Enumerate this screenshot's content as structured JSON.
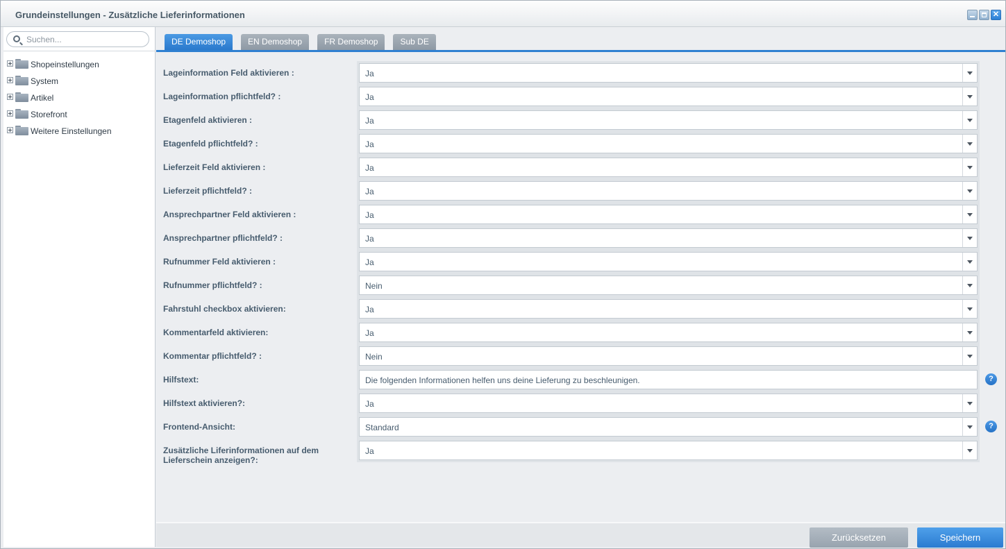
{
  "window": {
    "title": "Grundeinstellungen - Zusätzliche Lieferinformationen"
  },
  "sidebar": {
    "search": {
      "placeholder": "Suchen..."
    },
    "tree": [
      {
        "label": "Shopeinstellungen"
      },
      {
        "label": "System"
      },
      {
        "label": "Artikel"
      },
      {
        "label": "Storefront"
      },
      {
        "label": "Weitere Einstellungen"
      }
    ]
  },
  "tabs": [
    {
      "label": "DE Demoshop",
      "active": true
    },
    {
      "label": "EN Demoshop",
      "active": false
    },
    {
      "label": "FR Demoshop",
      "active": false
    },
    {
      "label": "Sub DE",
      "active": false
    }
  ],
  "form": {
    "rows": [
      {
        "label": "Lageinformation Feld aktivieren :",
        "value": "Ja"
      },
      {
        "label": "Lageinformation pflichtfeld? :",
        "value": "Ja"
      },
      {
        "label": "Etagenfeld aktivieren :",
        "value": "Ja"
      },
      {
        "label": "Etagenfeld pflichtfeld? :",
        "value": "Ja"
      },
      {
        "label": "Lieferzeit Feld aktivieren :",
        "value": "Ja"
      },
      {
        "label": "Lieferzeit pflichtfeld? :",
        "value": "Ja"
      },
      {
        "label": "Ansprechpartner Feld aktivieren :",
        "value": "Ja"
      },
      {
        "label": "Ansprechpartner pflichtfeld? :",
        "value": "Ja"
      },
      {
        "label": "Rufnummer Feld aktivieren :",
        "value": "Ja"
      },
      {
        "label": "Rufnummer pflichtfeld? :",
        "value": "Nein"
      },
      {
        "label": "Fahrstuhl checkbox aktivieren:",
        "value": "Ja"
      },
      {
        "label": "Kommentarfeld aktivieren:",
        "value": "Ja"
      },
      {
        "label": "Kommentar pflichtfeld? :",
        "value": "Nein"
      },
      {
        "label": "Hilfstext:",
        "value": "Die folgenden Informationen helfen uns deine Lieferung zu beschleunigen."
      },
      {
        "label": "Hilfstext aktivieren?:",
        "value": "Ja"
      },
      {
        "label": "Frontend-Ansicht:",
        "value": "Standard"
      },
      {
        "label": "Zusätzliche Liferinformationen auf dem Lieferschein anzeigen?:",
        "value": "Ja"
      }
    ],
    "help_glyph": "?"
  },
  "footer": {
    "reset_label": "Zurücksetzen",
    "save_label": "Speichern"
  },
  "colors": {
    "accent": "#2f80d1",
    "tab_inactive": "#98a3ae",
    "label_text": "#475c6e"
  }
}
